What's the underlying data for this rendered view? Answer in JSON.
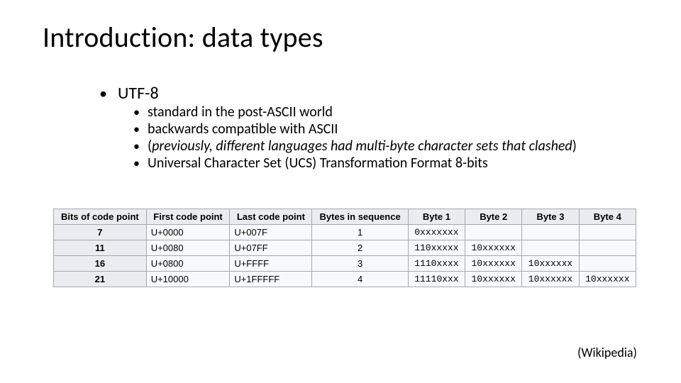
{
  "title": "Introduction: data types",
  "bullets": {
    "level1": "UTF-8",
    "level2": {
      "a": "standard in the post-ASCII world",
      "b": "backwards compatible with ASCII",
      "c_pre": "(",
      "c_em": "previously, different languages had multi-byte character sets that clashed",
      "c_post": ")",
      "d": "Universal Character Set (UCS) Transformation Format 8-bits"
    }
  },
  "table": {
    "headers": {
      "bits": "Bits of code point",
      "first": "First code point",
      "last": "Last code point",
      "bytes": "Bytes in sequence",
      "b1": "Byte 1",
      "b2": "Byte 2",
      "b3": "Byte 3",
      "b4": "Byte 4"
    },
    "rows": [
      {
        "bits": "7",
        "first": "U+0000",
        "last": "U+007F",
        "bytes": "1",
        "b1": "0xxxxxxx",
        "b2": "",
        "b3": "",
        "b4": ""
      },
      {
        "bits": "11",
        "first": "U+0080",
        "last": "U+07FF",
        "bytes": "2",
        "b1": "110xxxxx",
        "b2": "10xxxxxx",
        "b3": "",
        "b4": ""
      },
      {
        "bits": "16",
        "first": "U+0800",
        "last": "U+FFFF",
        "bytes": "3",
        "b1": "1110xxxx",
        "b2": "10xxxxxx",
        "b3": "10xxxxxx",
        "b4": ""
      },
      {
        "bits": "21",
        "first": "U+10000",
        "last": "U+1FFFFF",
        "bytes": "4",
        "b1": "11110xxx",
        "b2": "10xxxxxx",
        "b3": "10xxxxxx",
        "b4": "10xxxxxx"
      }
    ]
  },
  "citation": "(Wikipedia)"
}
